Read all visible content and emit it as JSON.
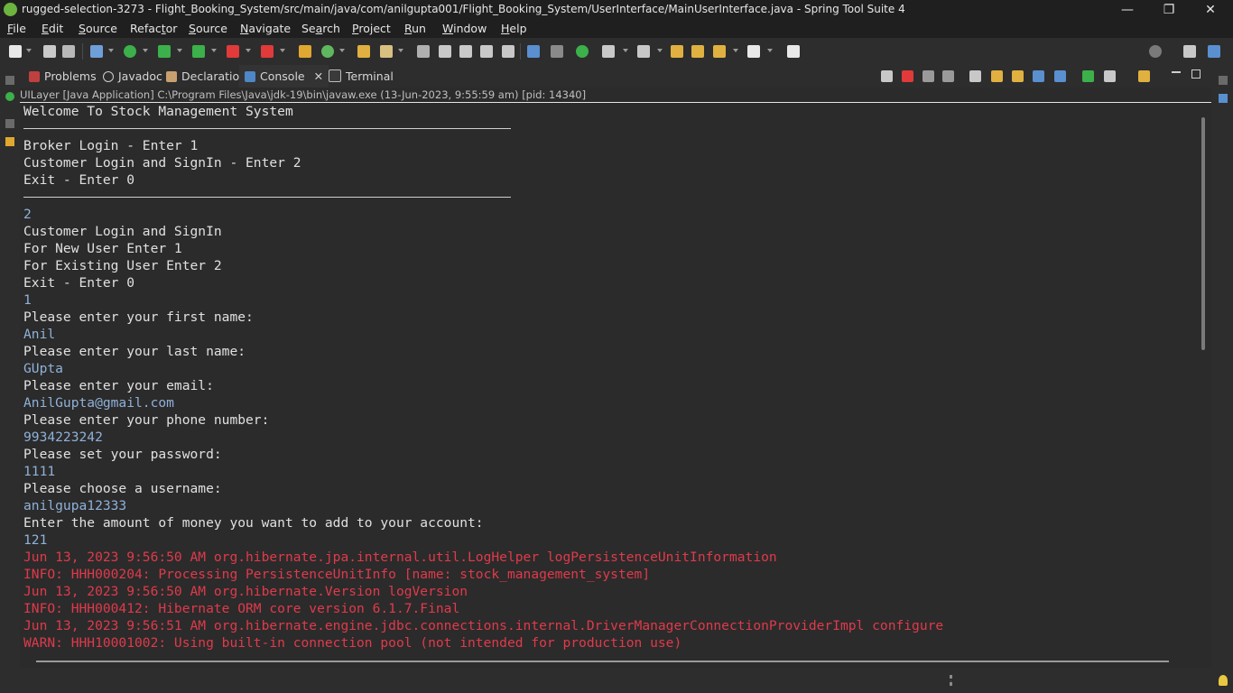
{
  "window": {
    "title": "rugged-selection-3273 - Flight_Booking_System/src/main/java/com/anilgupta001/Flight_Booking_System/UserInterface/MainUserInterface.java - Spring Tool Suite 4",
    "controls": {
      "minimize": "—",
      "restore": "❐",
      "close": "✕"
    }
  },
  "menu": [
    {
      "mnemonic": "F",
      "rest": "ile"
    },
    {
      "mnemonic": "E",
      "rest": "dit"
    },
    {
      "mnemonic": "S",
      "rest": "ource"
    },
    {
      "mnemonic": "",
      "pre": "Refac",
      "mn2": "t",
      "post": "or"
    },
    {
      "mnemonic": "S",
      "rest": "ource"
    },
    {
      "mnemonic": "N",
      "rest": "avigate"
    },
    {
      "pre": "Se",
      "mn2": "a",
      "post": "rch"
    },
    {
      "mnemonic": "P",
      "rest": "roject"
    },
    {
      "mnemonic": "R",
      "rest": "un"
    },
    {
      "mnemonic": "W",
      "rest": "indow"
    },
    {
      "mnemonic": "H",
      "rest": "elp"
    }
  ],
  "views": {
    "tabs": [
      {
        "label": "Problems",
        "icon": "problems-icon"
      },
      {
        "label": "Javadoc",
        "icon": "javadoc-icon"
      },
      {
        "label": "Declaration",
        "icon": "declaration-icon"
      },
      {
        "label": "Console",
        "icon": "console-icon",
        "active": true
      },
      {
        "label": "Terminal",
        "icon": "terminal-icon"
      }
    ],
    "close_glyph": "✕"
  },
  "console": {
    "process": "UILayer [Java Application] C:\\Program Files\\Java\\jdk-19\\bin\\javaw.exe  (13-Jun-2023, 9:55:59 am) [pid: 14340]",
    "lines": [
      {
        "t": "out",
        "text": "Welcome To Stock Management System"
      },
      {
        "t": "rule",
        "text": ""
      },
      {
        "t": "out",
        "text": "Broker Login - Enter 1"
      },
      {
        "t": "out",
        "text": "Customer Login and SignIn - Enter 2"
      },
      {
        "t": "out",
        "text": "Exit - Enter 0"
      },
      {
        "t": "rule",
        "text": ""
      },
      {
        "t": "in",
        "text": "2"
      },
      {
        "t": "out",
        "text": "Customer Login and SignIn"
      },
      {
        "t": "out",
        "text": "For New User Enter 1"
      },
      {
        "t": "out",
        "text": "For Existing User Enter 2"
      },
      {
        "t": "out",
        "text": "Exit - Enter 0"
      },
      {
        "t": "in",
        "text": "1"
      },
      {
        "t": "out",
        "text": "Please enter your first name:"
      },
      {
        "t": "in",
        "text": "Anil"
      },
      {
        "t": "out",
        "text": "Please enter your last name:"
      },
      {
        "t": "in",
        "text": "GUpta"
      },
      {
        "t": "out",
        "text": "Please enter your email:"
      },
      {
        "t": "in",
        "text": "AnilGupta@gmail.com"
      },
      {
        "t": "out",
        "text": "Please enter your phone number:"
      },
      {
        "t": "in",
        "text": "9934223242"
      },
      {
        "t": "out",
        "text": "Please set your password:"
      },
      {
        "t": "in",
        "text": "1111"
      },
      {
        "t": "out",
        "text": "Please choose a username:"
      },
      {
        "t": "in",
        "text": "anilgupa12333"
      },
      {
        "t": "out",
        "text": "Enter the amount of money you want to add to your account:"
      },
      {
        "t": "in",
        "text": "121"
      },
      {
        "t": "err",
        "text": "Jun 13, 2023 9:56:50 AM org.hibernate.jpa.internal.util.LogHelper logPersistenceUnitInformation"
      },
      {
        "t": "err",
        "text": "INFO: HHH000204: Processing PersistenceUnitInfo [name: stock_management_system]"
      },
      {
        "t": "err",
        "text": "Jun 13, 2023 9:56:50 AM org.hibernate.Version logVersion"
      },
      {
        "t": "err",
        "text": "INFO: HHH000412: Hibernate ORM core version 6.1.7.Final"
      },
      {
        "t": "err",
        "text": "Jun 13, 2023 9:56:51 AM org.hibernate.engine.jdbc.connections.internal.DriverManagerConnectionProviderImpl configure"
      },
      {
        "t": "err",
        "text": "WARN: HHH10001002: Using built-in connection pool (not intended for production use)"
      }
    ]
  },
  "colors": {
    "console_bg": "#2b2b2b",
    "stdout": "#e0e0e0",
    "stdin": "#8fb1d9",
    "stderr": "#e03a4b",
    "active_tab_underline": "#3d8ee0"
  }
}
